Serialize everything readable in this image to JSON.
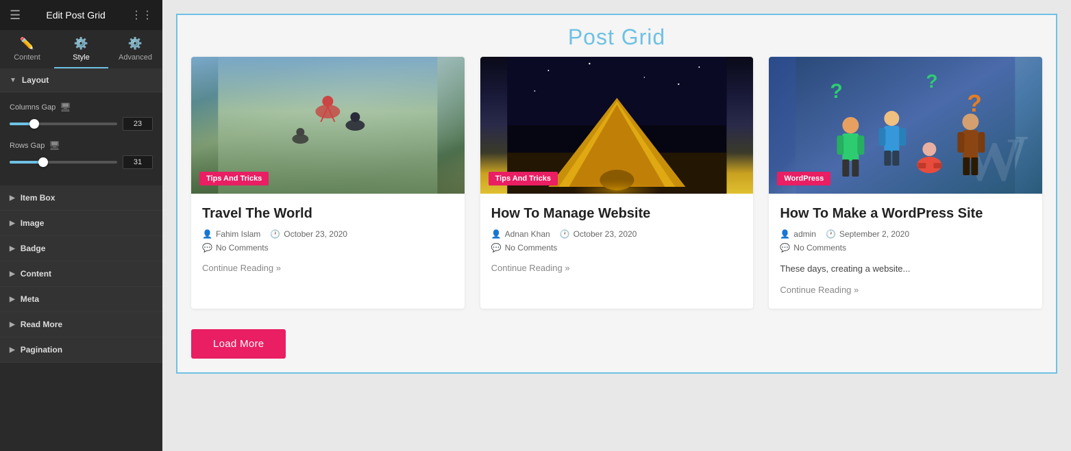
{
  "panel": {
    "title": "Edit Post Grid",
    "tabs": [
      {
        "id": "content",
        "label": "Content",
        "icon": "✏️",
        "active": false
      },
      {
        "id": "style",
        "label": "Style",
        "icon": "⚙️",
        "active": true
      },
      {
        "id": "advanced",
        "label": "Advanced",
        "icon": "⚙️",
        "active": false
      }
    ],
    "sections": {
      "layout": {
        "label": "Layout",
        "expanded": true,
        "controls": {
          "columns_gap": {
            "label": "Columns Gap",
            "value": 23,
            "min": 0,
            "max": 100,
            "percent": 23
          },
          "rows_gap": {
            "label": "Rows Gap",
            "value": 31,
            "min": 0,
            "max": 100,
            "percent": 31
          }
        }
      },
      "item_box": {
        "label": "Item Box",
        "expanded": false
      },
      "image": {
        "label": "Image",
        "expanded": false
      },
      "badge": {
        "label": "Badge",
        "expanded": false
      },
      "content": {
        "label": "Content",
        "expanded": false
      },
      "meta": {
        "label": "Meta",
        "expanded": false
      },
      "read_more": {
        "label": "Read More",
        "expanded": false
      },
      "pagination": {
        "label": "Pagination",
        "expanded": false
      }
    }
  },
  "main": {
    "page_title": "Post Grid",
    "posts": [
      {
        "id": 1,
        "title": "Travel The World",
        "badge": "Tips And Tricks",
        "author": "Fahim Islam",
        "date": "October 23, 2020",
        "comments": "No Comments",
        "excerpt": "",
        "read_more": "Continue Reading »",
        "image_type": "skydiving"
      },
      {
        "id": 2,
        "title": "How To Manage Website",
        "badge": "Tips And Tricks",
        "author": "Adnan Khan",
        "date": "October 23, 2020",
        "comments": "No Comments",
        "excerpt": "",
        "read_more": "Continue Reading »",
        "image_type": "tent"
      },
      {
        "id": 3,
        "title": "How To Make a WordPress Site",
        "badge": "WordPress",
        "author": "admin",
        "date": "September 2, 2020",
        "comments": "No Comments",
        "excerpt": "These days, creating a website...",
        "read_more": "Continue Reading »",
        "image_type": "wordpress"
      }
    ],
    "load_more_label": "Load More"
  }
}
